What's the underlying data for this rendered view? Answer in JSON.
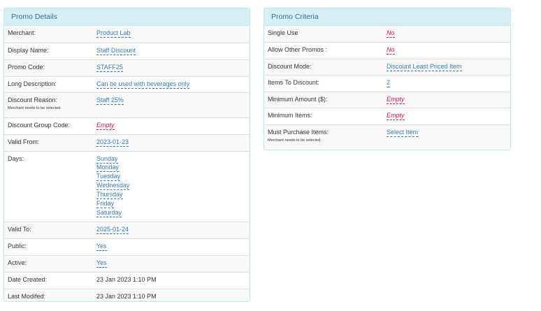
{
  "promo_details": {
    "title": "Promo Details",
    "merchant_label": "Merchant:",
    "merchant_value": "Product Lab",
    "display_name_label": "Display Name:",
    "display_name_value": "Staff Discount",
    "promo_code_label": "Promo Code:",
    "promo_code_value": "STAFF25",
    "long_description_label": "Long Description:",
    "long_description_value": "Can be used with beverages only",
    "discount_reason_label": "Discount Reason:",
    "discount_reason_note": "Merchant needs to be selected.",
    "discount_reason_value": "Staff 25%",
    "discount_group_code_label": "Discount Group Code:",
    "discount_group_code_value": "Empty",
    "valid_from_label": "Valid From:",
    "valid_from_value": "2023-01-23",
    "days_label": "Days:",
    "days": [
      "Sunday",
      "Monday",
      "Tuesday",
      "Wednesday",
      "Thursday",
      "Friday",
      "Saturday"
    ],
    "valid_to_label": "Valid To:",
    "valid_to_value": "2025-01-24",
    "public_label": "Public:",
    "public_value": "Yes",
    "active_label": "Active:",
    "active_value": "Yes",
    "date_created_label": "Date Created:",
    "date_created_value": "23 Jan 2023 1:10 PM",
    "last_modified_label": "Last Modifed:",
    "last_modified_value": "23 Jan 2023 1:10 PM"
  },
  "promo_criteria": {
    "title": "Promo Criteria",
    "single_use_label": "Single Use",
    "single_use_value": "No",
    "allow_other_promos_label": "Allow Other Promos :",
    "allow_other_promos_value": "No",
    "discount_mode_label": "Discount Mode:",
    "discount_mode_value": "Discount Least Priced Item",
    "items_to_discount_label": "Items To Discount:",
    "items_to_discount_value": "2",
    "minimum_amount_label": "Minimum Amount ($):",
    "minimum_amount_value": "Empty",
    "minimum_items_label": "Minimum Items:",
    "minimum_items_value": "Empty",
    "must_purchase_items_label": "Must Purchase Items:",
    "must_purchase_items_note": "Merchant needs to be selected.",
    "must_purchase_items_value": "Select Item"
  },
  "colors": {
    "heading_bg": "#d9edf7",
    "heading_text": "#31708f",
    "panel_border": "#bce8f1",
    "link": "#337ab7",
    "empty": "#dd1144"
  }
}
